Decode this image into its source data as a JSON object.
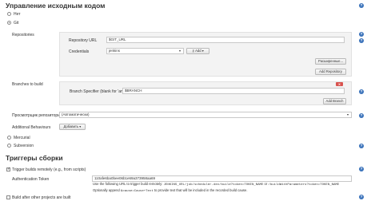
{
  "scm": {
    "title": "Управление исходным кодом",
    "option_none": "Нет",
    "option_git": "Git",
    "repositories_label": "Repositories",
    "repo_url_label": "Repository URL",
    "repo_url_value": "$GIT_URL",
    "credentials_label": "Credentials",
    "credentials_value": "jenkins",
    "add_button": "Add",
    "advanced_button": "Расширенные...",
    "add_repository_button": "Add Repository",
    "branches_label": "Branches to build",
    "branch_specifier_label": "Branch Specifier (blank for 'any')",
    "branch_specifier_value": "$BRANCH",
    "delete_label": "X",
    "add_branch_button": "Add Branch",
    "repo_browser_label": "Просмотрщик репозитория",
    "repo_browser_value": "(Автоматически)",
    "additional_behaviours_label": "Additional Behaviours",
    "add_behaviour_button": "Добавить",
    "option_mercurial": "Mercurial",
    "option_subversion": "Subversion"
  },
  "triggers": {
    "title": "Триггеры сборки",
    "remote_label": "Trigger builds remotely (e.g., from scripts)",
    "auth_token_label": "Authentication Token",
    "auth_token_value": "110afe6ba0bee06b1e69a373958aa69",
    "note_prefix": "Use the following URL to trigger build remotely: ",
    "note_url1": "JENKINS_URL/job/scheduler-dev/build?token=TOKEN_NAME",
    "note_or": " or ",
    "note_url2": "/buildWithParameters?token=TOKEN_NAME",
    "note_line2_prefix": "Optionally append ",
    "note_cause": "&cause=Cause+Text",
    "note_line2_suffix": " to provide text that will be included in the recorded build cause.",
    "after_other_label": "Build after other projects are built"
  },
  "icons": {
    "help": "help-icon",
    "dropdown": "chevron-down-icon",
    "key": "key-icon"
  },
  "colors": {
    "help": "#3a72ba",
    "delete": "#d9534f"
  }
}
